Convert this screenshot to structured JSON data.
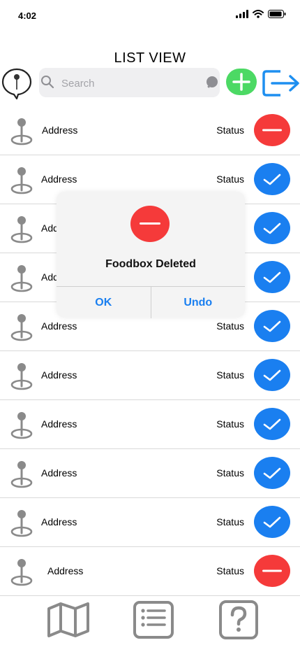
{
  "status_bar": {
    "time": "4:02"
  },
  "header": {
    "title": "LIST VIEW",
    "search": {
      "placeholder": "Search",
      "value": ""
    }
  },
  "list": {
    "items": [
      {
        "address": "Address",
        "status": "Status",
        "state": "deleted"
      },
      {
        "address": "Address",
        "status": "Status",
        "state": "checked"
      },
      {
        "address": "Address",
        "status": "Status",
        "state": "checked"
      },
      {
        "address": "Address",
        "status": "Status",
        "state": "checked"
      },
      {
        "address": "Address",
        "status": "Status",
        "state": "checked"
      },
      {
        "address": "Address",
        "status": "Status",
        "state": "checked"
      },
      {
        "address": "Address",
        "status": "Status",
        "state": "checked"
      },
      {
        "address": "Address",
        "status": "Status",
        "state": "checked"
      },
      {
        "address": "Address",
        "status": "Status",
        "state": "checked"
      },
      {
        "address": "Address",
        "status": "Status",
        "state": "deleted"
      }
    ]
  },
  "dialog": {
    "title": "Foodbox Deleted",
    "ok_label": "OK",
    "undo_label": "Undo"
  },
  "tab_bar": {
    "icons": [
      "map-icon",
      "list-icon",
      "help-icon"
    ]
  },
  "colors": {
    "accent_blue": "#1a7ff0",
    "delete_red": "#f53a3a",
    "add_green": "#4cd964",
    "icon_gray": "#8a8a8a"
  }
}
